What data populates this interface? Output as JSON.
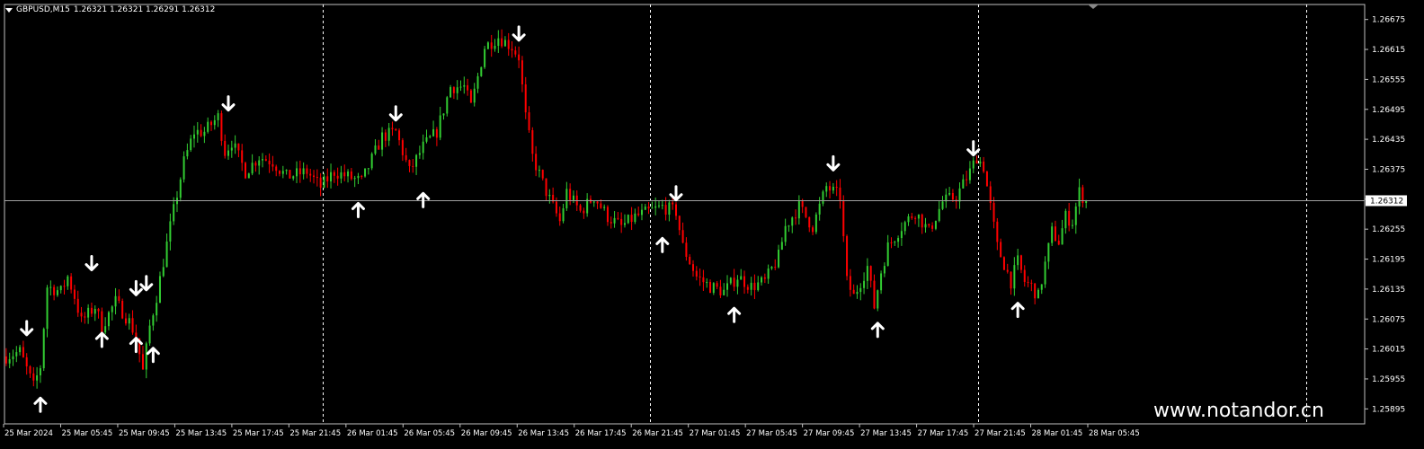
{
  "header": {
    "symbol": "GBPUSD,M15",
    "quote": "1.26321 1.26321 1.26291 1.26312"
  },
  "watermark": "www.notandor.cn",
  "colors": {
    "background": "#000000",
    "bull": "#32cd32",
    "bear": "#ff0000",
    "axis": "#c0c0c0",
    "text": "#ffffff",
    "separator": "#ffffff",
    "price_line": "#a0a0a0",
    "signal_arrow": "#ffffff"
  },
  "chart_data": {
    "type": "candlestick",
    "symbol": "GBPUSD",
    "timeframe": "M15",
    "ylim": [
      1.25865,
      1.26705
    ],
    "y_ticks": [
      "1.26675",
      "1.26615",
      "1.26555",
      "1.26495",
      "1.26435",
      "1.26375",
      "1.26315",
      "1.26255",
      "1.26195",
      "1.26135",
      "1.26075",
      "1.26015",
      "1.25955",
      "1.25895"
    ],
    "current_price": "1.26312",
    "x_labels": [
      "25 Mar 2024",
      "25 Mar 05:45",
      "25 Mar 09:45",
      "25 Mar 13:45",
      "25 Mar 17:45",
      "25 Mar 21:45",
      "26 Mar 01:45",
      "26 Mar 05:45",
      "26 Mar 09:45",
      "26 Mar 13:45",
      "26 Mar 17:45",
      "26 Mar 21:45",
      "27 Mar 01:45",
      "27 Mar 05:45",
      "27 Mar 09:45",
      "27 Mar 13:45",
      "27 Mar 17:45",
      "27 Mar 21:45",
      "28 Mar 01:45",
      "28 Mar 05:45"
    ],
    "day_separator_bars": [
      93,
      189,
      285,
      381
    ],
    "total_bar_slots": 398,
    "path": [
      [
        0,
        1.26
      ],
      [
        4,
        1.2601
      ],
      [
        8,
        1.2594
      ],
      [
        10,
        1.2598
      ],
      [
        12,
        1.2614
      ],
      [
        16,
        1.2613
      ],
      [
        18,
        1.2616
      ],
      [
        20,
        1.2612
      ],
      [
        22,
        1.2607
      ],
      [
        26,
        1.261
      ],
      [
        28,
        1.2606
      ],
      [
        32,
        1.2611
      ],
      [
        36,
        1.2607
      ],
      [
        38,
        1.2604
      ],
      [
        40,
        1.2597
      ],
      [
        42,
        1.2606
      ],
      [
        44,
        1.2612
      ],
      [
        48,
        1.2626
      ],
      [
        52,
        1.2639
      ],
      [
        55,
        1.2645
      ],
      [
        58,
        1.2645
      ],
      [
        62,
        1.2648
      ],
      [
        64,
        1.2641
      ],
      [
        66,
        1.2643
      ],
      [
        70,
        1.2637
      ],
      [
        74,
        1.264
      ],
      [
        78,
        1.2639
      ],
      [
        82,
        1.2636
      ],
      [
        88,
        1.2637
      ],
      [
        92,
        1.2634
      ],
      [
        96,
        1.2637
      ],
      [
        100,
        1.2636
      ],
      [
        104,
        1.2635
      ],
      [
        106,
        1.2638
      ],
      [
        110,
        1.2644
      ],
      [
        114,
        1.2645
      ],
      [
        116,
        1.2641
      ],
      [
        118,
        1.2637
      ],
      [
        122,
        1.2642
      ],
      [
        126,
        1.2645
      ],
      [
        130,
        1.2654
      ],
      [
        134,
        1.2654
      ],
      [
        136,
        1.265
      ],
      [
        140,
        1.2662
      ],
      [
        144,
        1.2664
      ],
      [
        148,
        1.2662
      ],
      [
        150,
        1.266
      ],
      [
        152,
        1.2648
      ],
      [
        154,
        1.264
      ],
      [
        158,
        1.2633
      ],
      [
        162,
        1.2627
      ],
      [
        164,
        1.2633
      ],
      [
        168,
        1.2629
      ],
      [
        172,
        1.2632
      ],
      [
        176,
        1.2628
      ],
      [
        180,
        1.2626
      ],
      [
        184,
        1.2628
      ],
      [
        188,
        1.2629
      ],
      [
        192,
        1.263
      ],
      [
        196,
        1.2629
      ],
      [
        198,
        1.2622
      ],
      [
        202,
        1.2616
      ],
      [
        206,
        1.2614
      ],
      [
        210,
        1.2613
      ],
      [
        214,
        1.2616
      ],
      [
        218,
        1.2614
      ],
      [
        222,
        1.2615
      ],
      [
        226,
        1.262
      ],
      [
        228,
        1.2626
      ],
      [
        232,
        1.263
      ],
      [
        236,
        1.2626
      ],
      [
        240,
        1.2634
      ],
      [
        242,
        1.2633
      ],
      [
        244,
        1.2632
      ],
      [
        246,
        1.2615
      ],
      [
        248,
        1.2612
      ],
      [
        252,
        1.2618
      ],
      [
        254,
        1.261
      ],
      [
        256,
        1.2617
      ],
      [
        258,
        1.2622
      ],
      [
        262,
        1.2626
      ],
      [
        266,
        1.2629
      ],
      [
        270,
        1.2625
      ],
      [
        274,
        1.2631
      ],
      [
        278,
        1.2632
      ],
      [
        282,
        1.2637
      ],
      [
        284,
        1.264
      ],
      [
        286,
        1.2638
      ],
      [
        290,
        1.2622
      ],
      [
        294,
        1.2615
      ],
      [
        296,
        1.2619
      ],
      [
        298,
        1.2615
      ],
      [
        300,
        1.2614
      ],
      [
        302,
        1.2612
      ],
      [
        306,
        1.2625
      ],
      [
        308,
        1.2623
      ],
      [
        310,
        1.2628
      ],
      [
        312,
        1.2627
      ],
      [
        314,
        1.2633
      ],
      [
        316,
        1.2631
      ]
    ],
    "signals_down": [
      [
        6,
        1.2602
      ],
      [
        25,
        1.2615
      ],
      [
        38,
        1.261
      ],
      [
        41,
        1.2611
      ],
      [
        65,
        1.2647
      ],
      [
        114,
        1.2645
      ],
      [
        150,
        1.2661
      ],
      [
        196,
        1.2629
      ],
      [
        242,
        1.2635
      ],
      [
        283,
        1.2638
      ]
    ],
    "signals_up": [
      [
        10,
        1.2594
      ],
      [
        28,
        1.2607
      ],
      [
        38,
        1.2606
      ],
      [
        43,
        1.2604
      ],
      [
        103,
        1.2633
      ],
      [
        122,
        1.2635
      ],
      [
        192,
        1.2626
      ],
      [
        213,
        1.2612
      ],
      [
        255,
        1.2609
      ],
      [
        296,
        1.2613
      ]
    ]
  }
}
